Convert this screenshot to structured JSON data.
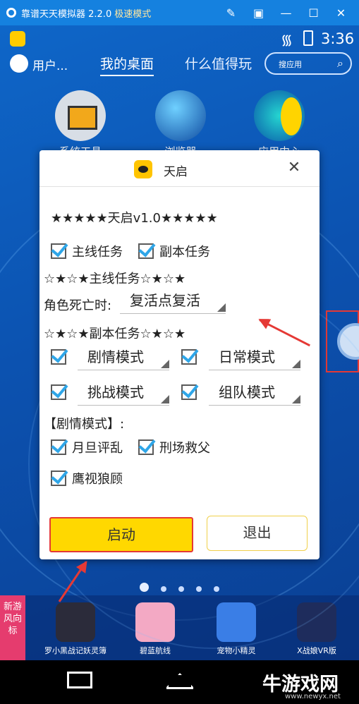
{
  "window": {
    "title": "靠谱天天模拟器 2.2.0",
    "mode": "极速模式",
    "controls": [
      "pin-icon",
      "restore-icon",
      "minimize-icon",
      "maximize-icon",
      "close-icon"
    ]
  },
  "statusbar": {
    "time": "3:36"
  },
  "topnav": {
    "user": "用户...",
    "tabs": [
      "我的桌面",
      "什么值得玩"
    ],
    "search_placeholder": "搜应用"
  },
  "desktop_icons": [
    {
      "label": "系统工具"
    },
    {
      "label": "浏览器"
    },
    {
      "label": "应用中心"
    }
  ],
  "dialog": {
    "title": "天启",
    "header_line": "★★★★★天启v1.0★★★★★",
    "main_quest": "主线任务",
    "dungeon_quest": "副本任务",
    "main_section": "☆★☆★主线任务☆★☆★",
    "death_label": "角色死亡时:",
    "death_option": "复活点复活",
    "dungeon_section": "☆★☆★副本任务☆★☆★",
    "modes": [
      "剧情模式",
      "日常模式",
      "挑战模式",
      "组队模式"
    ],
    "story_header": "【剧情模式】:",
    "story_tasks": [
      "月旦评乱",
      "刑场救父",
      "鹰视狼顾"
    ],
    "start_label": "启动",
    "exit_label": "退出"
  },
  "app_rail": {
    "tag": "新游风向标",
    "apps": [
      {
        "name": "罗小黑战记妖灵簿"
      },
      {
        "name": "碧蓝航线"
      },
      {
        "name": "宠物小精灵"
      },
      {
        "name": "X战娘VR版"
      }
    ]
  },
  "watermark": {
    "text": "牛游戏网",
    "url": "www.newyx.net"
  },
  "colors": {
    "titlebar": "#1581df",
    "desktop": "#0c52b0",
    "accent_yellow": "#ffd800",
    "highlight_red": "#e53935",
    "check_blue": "#2fa6e8"
  }
}
